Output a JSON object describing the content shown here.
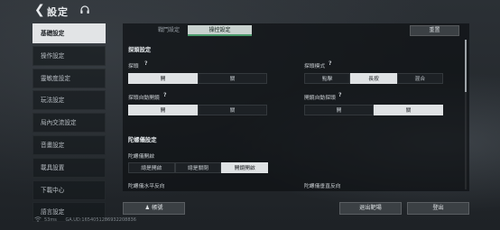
{
  "header": {
    "back_icon": "chevron-left-icon",
    "title": "設定",
    "headset_icon": "headset-icon"
  },
  "sidebar": {
    "items": [
      {
        "label": "基礎設定",
        "active": true
      },
      {
        "label": "操作設定",
        "active": false
      },
      {
        "label": "靈敏度設定",
        "active": false
      },
      {
        "label": "玩法設定",
        "active": false
      },
      {
        "label": "局內交流設定",
        "active": false
      },
      {
        "label": "音畫設定",
        "active": false
      },
      {
        "label": "載具設置",
        "active": false
      },
      {
        "label": "下載中心",
        "active": false
      },
      {
        "label": "語言設定",
        "active": false
      }
    ]
  },
  "tabs": [
    {
      "label": "戰鬥設定",
      "active": false
    },
    {
      "label": "操控設定",
      "active": true
    }
  ],
  "reset_label": "重置",
  "sections": {
    "lean": {
      "title": "探頭設定",
      "lean_label": "探頭",
      "lean_options": [
        "開",
        "關"
      ],
      "lean_selected": 0,
      "lean_mode_label": "探頭模式",
      "lean_mode_options": [
        "點擊",
        "長按",
        "混合"
      ],
      "lean_mode_selected": 1,
      "auto_aim_label": "探頭自動開鏡",
      "auto_aim_options": [
        "開",
        "關"
      ],
      "auto_aim_selected": 0,
      "aim_auto_lean_label": "開鏡自動探頭",
      "aim_auto_lean_options": [
        "開",
        "關"
      ],
      "aim_auto_lean_selected": 1
    },
    "gyro": {
      "title": "陀螺儀設定",
      "gyro_on_label": "陀螺儀開啟",
      "gyro_options": [
        "總是開啟",
        "總是關閉",
        "開鏡開啟"
      ],
      "gyro_selected": 2,
      "horizontal_label": "陀螺儀水平反向",
      "vertical_label": "陀螺儀垂直反向"
    }
  },
  "buttons": {
    "account_label": "帳號",
    "exit_lobby_label": "退出靶場",
    "logout_label": "登出"
  },
  "status": {
    "ping": "53ms",
    "uid": "GA.UD:1654051286932208836"
  }
}
